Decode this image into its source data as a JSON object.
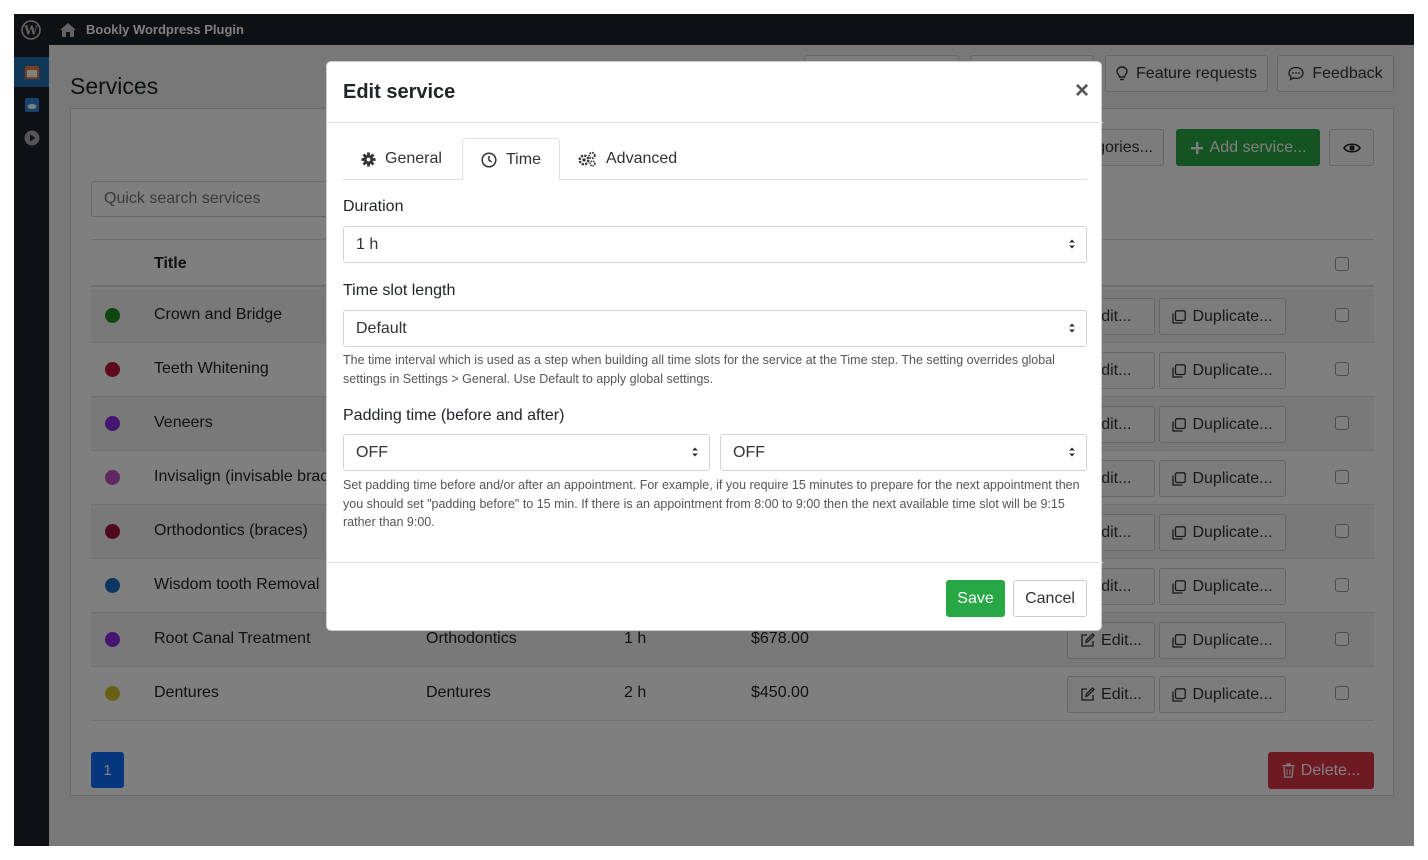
{
  "topbar": {
    "site_name": "Bookly Wordpress Plugin"
  },
  "page": {
    "title": "Services"
  },
  "header_buttons": {
    "feature_requests": "Feature requests",
    "feedback": "Feedback"
  },
  "toolbar": {
    "categories_label": "gories...",
    "add_service_label": "Add service..."
  },
  "search": {
    "placeholder": "Quick search services"
  },
  "table": {
    "title_header": "Title",
    "edit_label": "Edit...",
    "duplicate_label": "Duplicate...",
    "rows": [
      {
        "title": "Crown and Bridge",
        "color": "#1e8a1e"
      },
      {
        "title": "Teeth Whitening",
        "color": "#c0143c"
      },
      {
        "title": "Veneers",
        "color": "#8a2be2"
      },
      {
        "title": "Invisalign (invisable brac",
        "color": "#c050c0"
      },
      {
        "title": "Orthodontics (braces)",
        "color": "#a0103a"
      },
      {
        "title": "Wisdom tooth Removal",
        "color": "#1a6fc4"
      },
      {
        "title": "Root Canal Treatment",
        "category": "Orthodontics",
        "duration": "1 h",
        "price": "$678.00",
        "color": "#8a2be2"
      },
      {
        "title": "Dentures",
        "category": "Dentures",
        "duration": "2 h",
        "price": "$450.00",
        "color": "#d4c02a"
      }
    ]
  },
  "pagination": {
    "current": "1"
  },
  "delete_label": "Delete...",
  "modal": {
    "title": "Edit service",
    "tabs": [
      {
        "label": "General",
        "icon": "gear-icon"
      },
      {
        "label": "Time",
        "icon": "clock-icon",
        "active": true
      },
      {
        "label": "Advanced",
        "icon": "gears-icon"
      }
    ],
    "duration": {
      "label": "Duration",
      "value": "1 h"
    },
    "slot_length": {
      "label": "Time slot length",
      "value": "Default",
      "help": "The time interval which is used as a step when building all time slots for the service at the Time step. The setting overrides global settings in Settings > General. Use Default to apply global settings."
    },
    "padding": {
      "label": "Padding time (before and after)",
      "before": "OFF",
      "after": "OFF",
      "help": "Set padding time before and/or after an appointment. For example, if you require 15 minutes to prepare for the next appointment then you should set \"padding before\" to 15 min. If there is an appointment from 8:00 to 9:00 then the next available time slot will be 9:15 rather than 9:00."
    },
    "save_label": "Save",
    "cancel_label": "Cancel"
  },
  "colors": {
    "accent_green": "#28a745",
    "accent_red": "#dc3545",
    "accent_blue": "#0d6efd",
    "admin_dark": "#1d2327"
  }
}
